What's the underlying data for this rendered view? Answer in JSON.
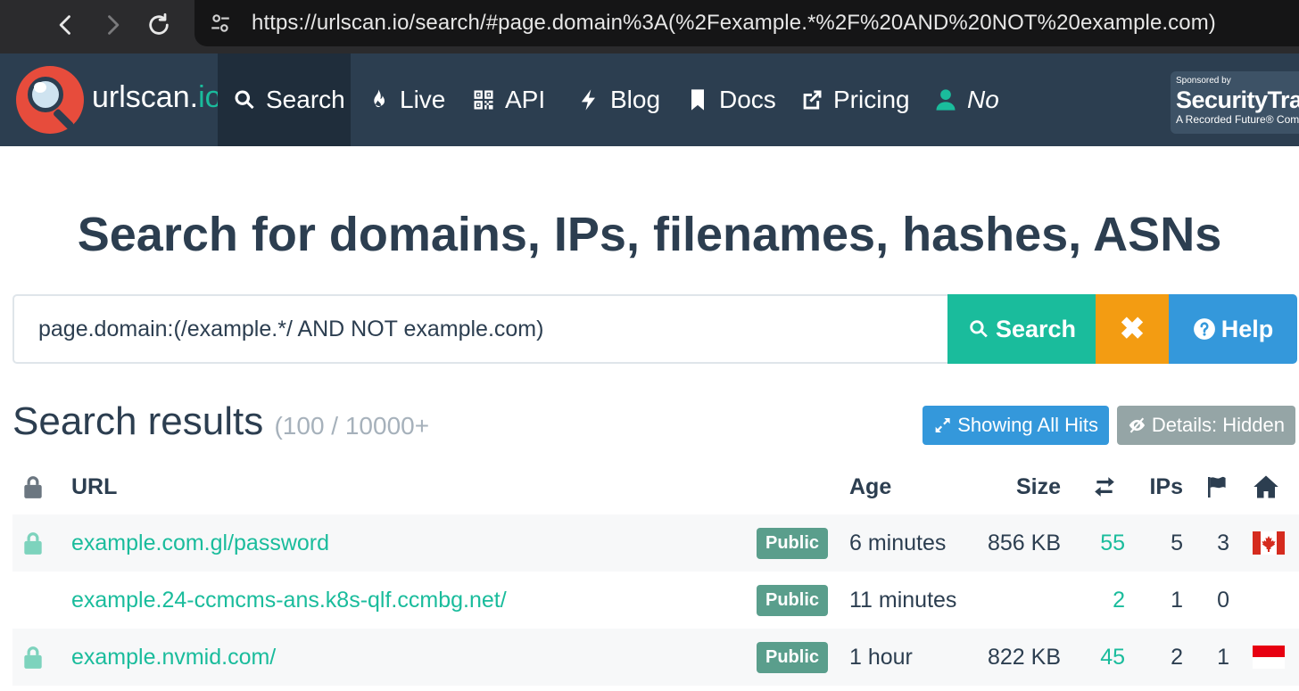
{
  "browser": {
    "url": "https://urlscan.io/search/#page.domain%3A(%2Fexample.*%2F%20AND%20NOT%20example.com)"
  },
  "nav": {
    "brand_main": "urlscan.",
    "brand_tld": "io",
    "items": [
      {
        "label": "Search",
        "icon": "search-icon"
      },
      {
        "label": "Live",
        "icon": "fire-icon"
      },
      {
        "label": "API",
        "icon": "qrcode-icon"
      },
      {
        "label": "Blog",
        "icon": "bolt-icon"
      },
      {
        "label": "Docs",
        "icon": "bookmark-icon"
      },
      {
        "label": "Pricing",
        "icon": "external-link-icon"
      },
      {
        "label": "No",
        "icon": "user-icon"
      }
    ],
    "sponsor": {
      "line1": "Sponsored by",
      "line2": "SecurityTrails",
      "line3": "A Recorded Future® Company"
    }
  },
  "hero": {
    "title": "Search for domains, IPs, filenames, hashes, ASNs"
  },
  "search": {
    "query": "page.domain:(/example.*/ AND NOT example.com)",
    "search_label": "Search",
    "clear_label": "✖",
    "help_label": "Help"
  },
  "results": {
    "title": "Search results",
    "count": "(100 / 10000+",
    "showing_all_label": "Showing All Hits",
    "details_label": "Details: Hidden",
    "columns": {
      "url": "URL",
      "age": "Age",
      "size": "Size",
      "ips": "IPs"
    },
    "rows": [
      {
        "locked": true,
        "url": "example.com.gl/password",
        "badge": "Public",
        "age": "6 minutes",
        "size": "856 KB",
        "requests": "55",
        "ips": "5",
        "countries": "3",
        "flag": "canada"
      },
      {
        "locked": false,
        "url": "example.24-ccmcms-ans.k8s-qlf.ccmbg.net/",
        "badge": "Public",
        "age": "11 minutes",
        "size": "",
        "requests": "2",
        "ips": "1",
        "countries": "0",
        "flag": ""
      },
      {
        "locked": true,
        "url": "example.nvmid.com/",
        "badge": "Public",
        "age": "1 hour",
        "size": "822 KB",
        "requests": "45",
        "ips": "2",
        "countries": "1",
        "flag": "indonesia"
      }
    ]
  },
  "colors": {
    "nav_bg": "#2c3e50",
    "accent": "#1abc9c",
    "warn": "#f39c12",
    "info": "#3498db",
    "muted": "#95a5a6"
  }
}
